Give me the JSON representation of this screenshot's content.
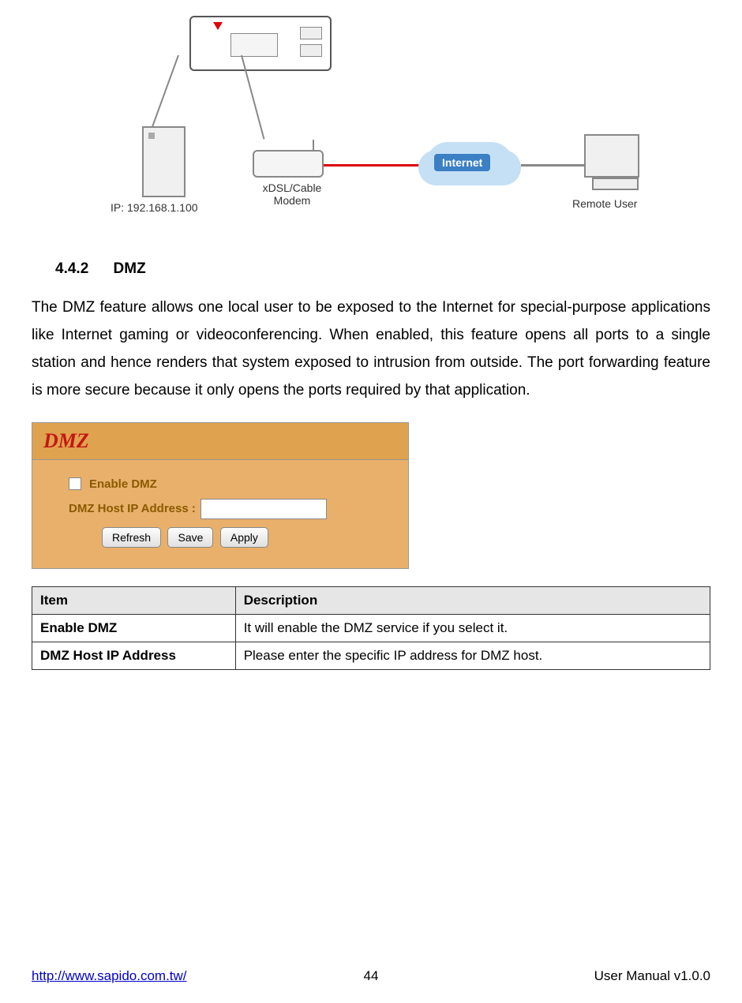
{
  "diagram": {
    "ip_label": "IP: 192.168.1.100",
    "modem_label": "xDSL/Cable\nModem",
    "cloud_label": "Internet",
    "remote_label": "Remote User"
  },
  "section": {
    "number": "4.4.2",
    "title": "DMZ"
  },
  "paragraph": "The DMZ feature allows one local user to be exposed to the Internet for special-purpose applications like Internet gaming or videoconferencing. When enabled, this feature opens all ports to a single station and hence renders that system exposed to intrusion from outside. The port forwarding feature is more secure because it only opens the ports required by that application.",
  "panel": {
    "title": "DMZ",
    "enable_label": "Enable DMZ",
    "host_label": "DMZ Host IP Address :",
    "buttons": {
      "refresh": "Refresh",
      "save": "Save",
      "apply": "Apply"
    }
  },
  "table": {
    "headers": {
      "item": "Item",
      "description": "Description"
    },
    "rows": [
      {
        "item": "Enable DMZ",
        "desc": "It will enable the DMZ service if you select it."
      },
      {
        "item": "DMZ Host IP Address",
        "desc": "Please enter the specific IP address for DMZ host."
      }
    ]
  },
  "footer": {
    "url": "http://www.sapido.com.tw/",
    "page": "44",
    "version": "User Manual v1.0.0"
  }
}
